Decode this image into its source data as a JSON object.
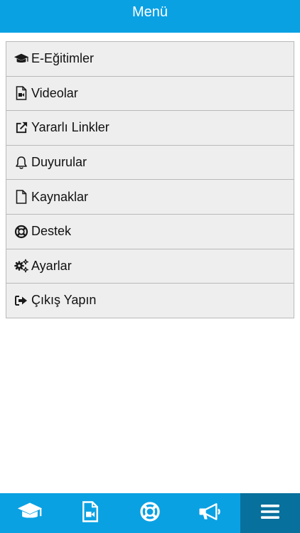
{
  "header": {
    "title": "Menü"
  },
  "menu": {
    "items": [
      {
        "label": "E-Eğitimler",
        "icon": "graduation-cap-icon"
      },
      {
        "label": "Videolar",
        "icon": "video-file-icon"
      },
      {
        "label": "Yararlı Linkler",
        "icon": "external-link-icon"
      },
      {
        "label": "Duyurular",
        "icon": "bell-icon"
      },
      {
        "label": "Kaynaklar",
        "icon": "file-icon"
      },
      {
        "label": "Destek",
        "icon": "life-ring-icon"
      },
      {
        "label": "Ayarlar",
        "icon": "cogs-icon"
      },
      {
        "label": "Çıkış Yapın",
        "icon": "sign-out-icon"
      }
    ]
  },
  "tabbar": {
    "tabs": [
      {
        "icon": "graduation-cap-icon",
        "active": false
      },
      {
        "icon": "video-file-icon",
        "active": false
      },
      {
        "icon": "life-ring-icon",
        "active": false
      },
      {
        "icon": "megaphone-icon",
        "active": false
      },
      {
        "icon": "hamburger-menu-icon",
        "active": true
      }
    ]
  },
  "colors": {
    "accent": "#0aa1e3",
    "active_tab": "#08709d",
    "item_background": "#eeeeee",
    "item_border": "#b9b9b9"
  }
}
